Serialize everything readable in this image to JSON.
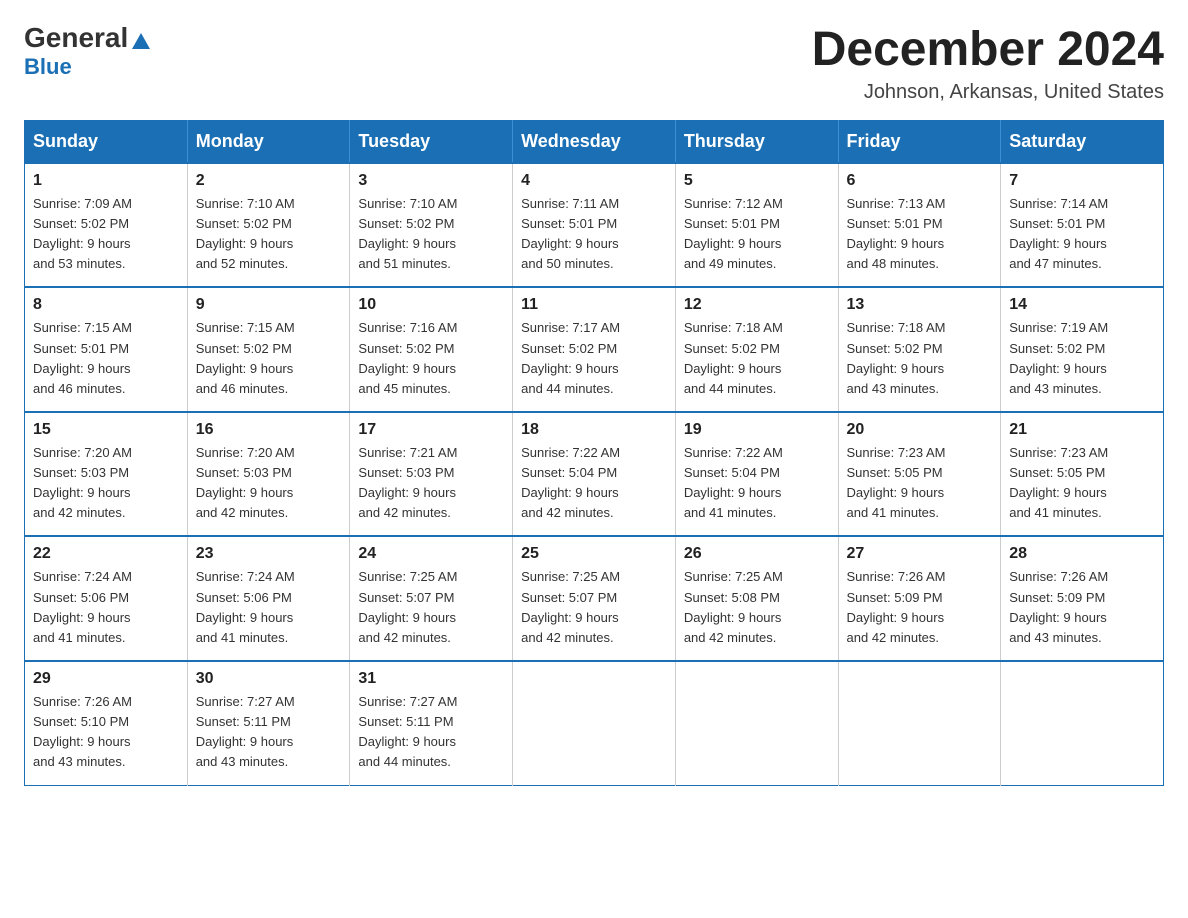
{
  "header": {
    "logo_general": "General",
    "logo_blue": "Blue",
    "month_title": "December 2024",
    "location": "Johnson, Arkansas, United States"
  },
  "weekdays": [
    "Sunday",
    "Monday",
    "Tuesday",
    "Wednesday",
    "Thursday",
    "Friday",
    "Saturday"
  ],
  "weeks": [
    [
      {
        "day": "1",
        "sunrise": "7:09 AM",
        "sunset": "5:02 PM",
        "daylight": "9 hours and 53 minutes."
      },
      {
        "day": "2",
        "sunrise": "7:10 AM",
        "sunset": "5:02 PM",
        "daylight": "9 hours and 52 minutes."
      },
      {
        "day": "3",
        "sunrise": "7:10 AM",
        "sunset": "5:02 PM",
        "daylight": "9 hours and 51 minutes."
      },
      {
        "day": "4",
        "sunrise": "7:11 AM",
        "sunset": "5:01 PM",
        "daylight": "9 hours and 50 minutes."
      },
      {
        "day": "5",
        "sunrise": "7:12 AM",
        "sunset": "5:01 PM",
        "daylight": "9 hours and 49 minutes."
      },
      {
        "day": "6",
        "sunrise": "7:13 AM",
        "sunset": "5:01 PM",
        "daylight": "9 hours and 48 minutes."
      },
      {
        "day": "7",
        "sunrise": "7:14 AM",
        "sunset": "5:01 PM",
        "daylight": "9 hours and 47 minutes."
      }
    ],
    [
      {
        "day": "8",
        "sunrise": "7:15 AM",
        "sunset": "5:01 PM",
        "daylight": "9 hours and 46 minutes."
      },
      {
        "day": "9",
        "sunrise": "7:15 AM",
        "sunset": "5:02 PM",
        "daylight": "9 hours and 46 minutes."
      },
      {
        "day": "10",
        "sunrise": "7:16 AM",
        "sunset": "5:02 PM",
        "daylight": "9 hours and 45 minutes."
      },
      {
        "day": "11",
        "sunrise": "7:17 AM",
        "sunset": "5:02 PM",
        "daylight": "9 hours and 44 minutes."
      },
      {
        "day": "12",
        "sunrise": "7:18 AM",
        "sunset": "5:02 PM",
        "daylight": "9 hours and 44 minutes."
      },
      {
        "day": "13",
        "sunrise": "7:18 AM",
        "sunset": "5:02 PM",
        "daylight": "9 hours and 43 minutes."
      },
      {
        "day": "14",
        "sunrise": "7:19 AM",
        "sunset": "5:02 PM",
        "daylight": "9 hours and 43 minutes."
      }
    ],
    [
      {
        "day": "15",
        "sunrise": "7:20 AM",
        "sunset": "5:03 PM",
        "daylight": "9 hours and 42 minutes."
      },
      {
        "day": "16",
        "sunrise": "7:20 AM",
        "sunset": "5:03 PM",
        "daylight": "9 hours and 42 minutes."
      },
      {
        "day": "17",
        "sunrise": "7:21 AM",
        "sunset": "5:03 PM",
        "daylight": "9 hours and 42 minutes."
      },
      {
        "day": "18",
        "sunrise": "7:22 AM",
        "sunset": "5:04 PM",
        "daylight": "9 hours and 42 minutes."
      },
      {
        "day": "19",
        "sunrise": "7:22 AM",
        "sunset": "5:04 PM",
        "daylight": "9 hours and 41 minutes."
      },
      {
        "day": "20",
        "sunrise": "7:23 AM",
        "sunset": "5:05 PM",
        "daylight": "9 hours and 41 minutes."
      },
      {
        "day": "21",
        "sunrise": "7:23 AM",
        "sunset": "5:05 PM",
        "daylight": "9 hours and 41 minutes."
      }
    ],
    [
      {
        "day": "22",
        "sunrise": "7:24 AM",
        "sunset": "5:06 PM",
        "daylight": "9 hours and 41 minutes."
      },
      {
        "day": "23",
        "sunrise": "7:24 AM",
        "sunset": "5:06 PM",
        "daylight": "9 hours and 41 minutes."
      },
      {
        "day": "24",
        "sunrise": "7:25 AM",
        "sunset": "5:07 PM",
        "daylight": "9 hours and 42 minutes."
      },
      {
        "day": "25",
        "sunrise": "7:25 AM",
        "sunset": "5:07 PM",
        "daylight": "9 hours and 42 minutes."
      },
      {
        "day": "26",
        "sunrise": "7:25 AM",
        "sunset": "5:08 PM",
        "daylight": "9 hours and 42 minutes."
      },
      {
        "day": "27",
        "sunrise": "7:26 AM",
        "sunset": "5:09 PM",
        "daylight": "9 hours and 42 minutes."
      },
      {
        "day": "28",
        "sunrise": "7:26 AM",
        "sunset": "5:09 PM",
        "daylight": "9 hours and 43 minutes."
      }
    ],
    [
      {
        "day": "29",
        "sunrise": "7:26 AM",
        "sunset": "5:10 PM",
        "daylight": "9 hours and 43 minutes."
      },
      {
        "day": "30",
        "sunrise": "7:27 AM",
        "sunset": "5:11 PM",
        "daylight": "9 hours and 43 minutes."
      },
      {
        "day": "31",
        "sunrise": "7:27 AM",
        "sunset": "5:11 PM",
        "daylight": "9 hours and 44 minutes."
      },
      null,
      null,
      null,
      null
    ]
  ],
  "labels": {
    "sunrise": "Sunrise: ",
    "sunset": "Sunset: ",
    "daylight": "Daylight: "
  }
}
